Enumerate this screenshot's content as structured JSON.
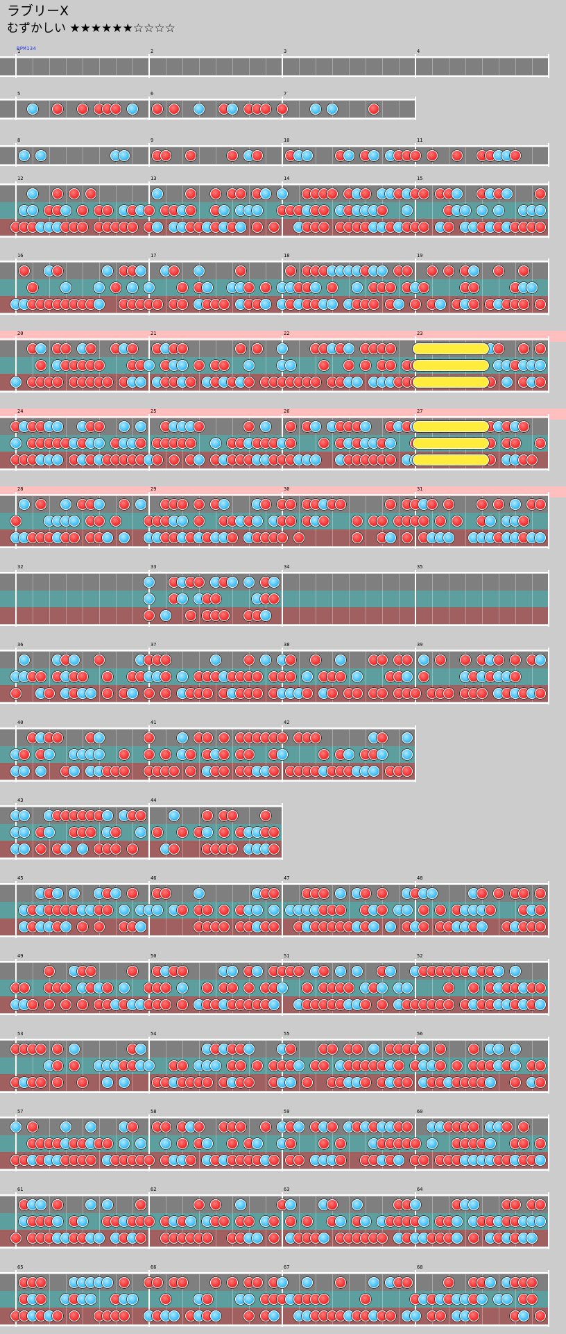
{
  "song": {
    "title": "ラブリーX",
    "difficulty": "むずかしい ★★★★★★☆☆☆☆",
    "bpm": "BPM134"
  },
  "colors": {
    "background": "#cccccc",
    "lane": "#7f7f7f",
    "lane_branch_normal": "#7f7f7f",
    "lane_branch_expert": "#5d9e9e",
    "lane_branch_master": "#a06060",
    "gogo": "#ffbfbf",
    "don": "#f03a3a",
    "ka": "#4ec3f5",
    "roll": "#ffec3d",
    "scroll_marker": "#f4d22a"
  },
  "rows": [
    {
      "measures": [
        "1",
        "2",
        "3",
        "4"
      ],
      "branched": false,
      "count": 4,
      "gogo": false
    },
    {
      "measures": [
        "5",
        "6",
        "7"
      ],
      "branched": false,
      "count": 3,
      "gogo": false
    },
    {
      "measures": [
        "8",
        "9",
        "10",
        "11"
      ],
      "branched": false,
      "count": 4,
      "gogo": false
    },
    {
      "measures": [
        "12",
        "13",
        "14",
        "15"
      ],
      "branched": true,
      "count": 4,
      "gogo": false
    },
    {
      "measures": [
        "16",
        "17",
        "18",
        "19"
      ],
      "branched": true,
      "count": 4,
      "gogo": false
    },
    {
      "measures": [
        "20",
        "21",
        "22",
        "23"
      ],
      "branched": true,
      "count": 4,
      "gogo": true
    },
    {
      "measures": [
        "24",
        "25",
        "26",
        "27"
      ],
      "branched": true,
      "count": 4,
      "gogo": true
    },
    {
      "measures": [
        "28",
        "29",
        "30",
        "31"
      ],
      "branched": true,
      "count": 4,
      "gogo": true
    },
    {
      "measures": [
        "32",
        "33",
        "34",
        "35"
      ],
      "branched": true,
      "count": 4,
      "gogo": false
    },
    {
      "measures": [
        "36",
        "37",
        "38",
        "39"
      ],
      "branched": true,
      "count": 4,
      "gogo": false
    },
    {
      "measures": [
        "40",
        "41",
        "42"
      ],
      "branched": true,
      "count": 3,
      "gogo": false
    },
    {
      "measures": [
        "43",
        "44"
      ],
      "branched": true,
      "count": 2,
      "gogo": false
    },
    {
      "measures": [
        "45",
        "46",
        "47",
        "48"
      ],
      "branched": true,
      "count": 4,
      "gogo": false
    },
    {
      "measures": [
        "49",
        "50",
        "51",
        "52"
      ],
      "branched": true,
      "count": 4,
      "gogo": false
    },
    {
      "measures": [
        "53",
        "54",
        "55",
        "56"
      ],
      "branched": true,
      "count": 4,
      "gogo": false
    },
    {
      "measures": [
        "57",
        "58",
        "59",
        "60"
      ],
      "branched": true,
      "count": 4,
      "gogo": false
    },
    {
      "measures": [
        "61",
        "62",
        "63",
        "64"
      ],
      "branched": true,
      "count": 4,
      "gogo": false
    },
    {
      "measures": [
        "65",
        "66",
        "67",
        "68"
      ],
      "branched": true,
      "count": 4,
      "gogo": false
    }
  ]
}
